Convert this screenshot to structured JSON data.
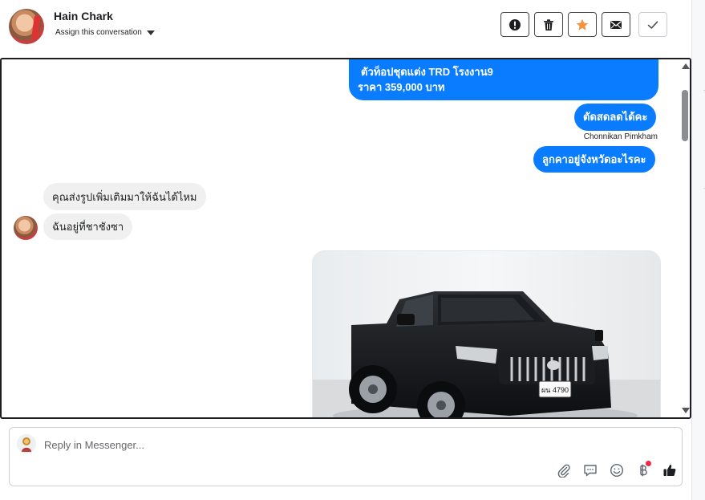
{
  "header": {
    "contact_name": "Hain Chark",
    "assign_label": "Assign this conversation",
    "actions": [
      "spam-icon",
      "trash-icon",
      "star-icon",
      "envelope-icon",
      "check-icon"
    ]
  },
  "messages": {
    "m1_line1": "ตัวท็อปชุดแต่ง TRD โรงงาน9",
    "m1_line2": "ราคา 359,000 บาท",
    "m2": "ตัดสดลดได้คะ",
    "m2_sender": "Chonnikan Pimkham",
    "m3": "ลูกคาอยู่จังหวัดอะไรคะ",
    "m4": "คุณส่งรูปเพิ่มเติมมาให้ฉันได้ไหม",
    "m5": "ฉันอยู่ที่ชาชังซา"
  },
  "photo": {
    "plate_text": "ผน 4790"
  },
  "composer": {
    "placeholder": "Reply in Messenger...",
    "tools": [
      "paperclip-icon",
      "comment-icon",
      "emoji-icon",
      "baht-icon",
      "like-icon"
    ]
  },
  "colors": {
    "outgoing": "#0a7cff",
    "incoming": "#f0f0f0",
    "star": "#f5923e",
    "badge": "#f02849"
  }
}
